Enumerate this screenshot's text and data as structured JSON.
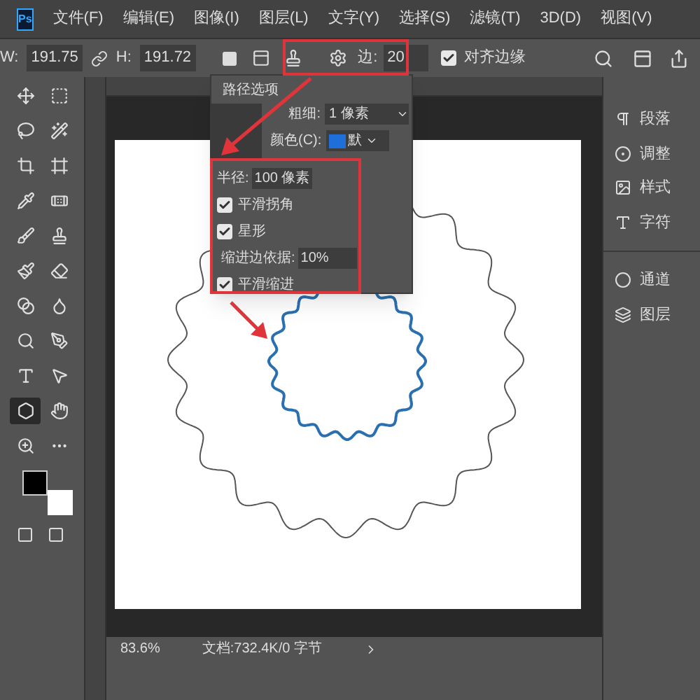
{
  "logo": "Ps",
  "menu": [
    "文件(F)",
    "编辑(E)",
    "图像(I)",
    "图层(L)",
    "文字(Y)",
    "选择(S)",
    "滤镜(T)",
    "3D(D)",
    "视图(V)"
  ],
  "options_bar": {
    "w_label": "W:",
    "w_value": "191.75",
    "h_label": "H:",
    "h_value": "191.72",
    "sides_label": "边:",
    "sides_value": "20",
    "align_edges": {
      "label": "对齐边缘",
      "checked": true
    }
  },
  "tools": [
    {
      "selected": false
    },
    {
      "selected": false
    },
    {
      "selected": false
    },
    {
      "selected": false
    },
    {
      "selected": false
    },
    {
      "selected": false
    },
    {
      "selected": false
    },
    {
      "selected": false
    },
    {
      "selected": false
    },
    {
      "selected": false
    },
    {
      "selected": false
    },
    {
      "selected": false
    },
    {
      "selected": false
    },
    {
      "selected": false
    },
    {
      "selected": false
    },
    {
      "selected": false
    },
    {
      "selected": false
    },
    {
      "selected": false
    },
    {
      "selected": true
    },
    {
      "selected": false
    },
    {
      "selected": false
    },
    {
      "selected": false
    }
  ],
  "path_options": {
    "title": "路径选项",
    "weight_label": "粗细:",
    "weight_value": "1 像素",
    "color_label": "颜色(C):",
    "color_value": "默",
    "radius_label": "半径:",
    "radius_value": "100 像素",
    "options": [
      {
        "kind": "checkbox",
        "label": "平滑拐角",
        "checked": true
      },
      {
        "kind": "checkbox",
        "label": "星形",
        "checked": true
      },
      {
        "kind": "field",
        "label": "缩进边依据:",
        "value": "10%"
      },
      {
        "kind": "checkbox",
        "label": "平滑缩进",
        "checked": true
      }
    ]
  },
  "panels": [
    {
      "label": "段落"
    },
    {
      "label": "调整"
    },
    {
      "label": "样式"
    },
    {
      "label": "字符"
    },
    {
      "label": "通道"
    },
    {
      "label": "图层"
    }
  ],
  "status_bar": {
    "zoom": "83.6%",
    "document": "文档:732.4K/0 字节"
  }
}
